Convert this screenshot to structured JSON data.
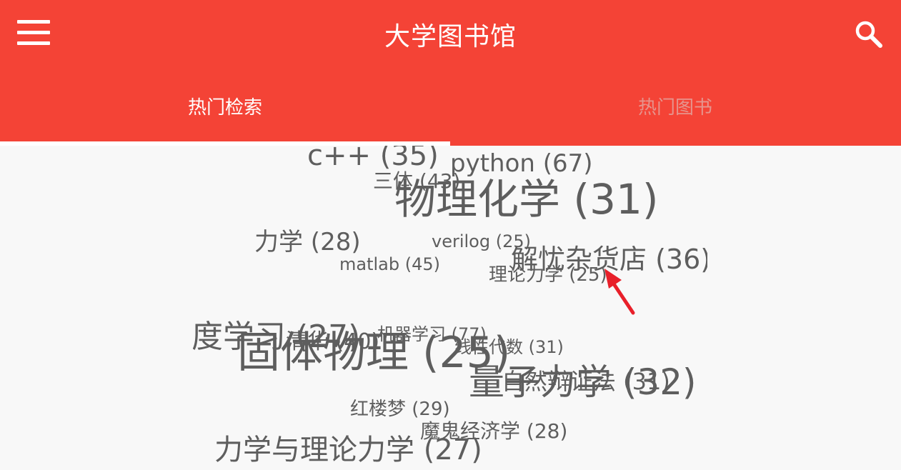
{
  "app": {
    "title": "大学图书馆",
    "menu_icon": "hamburger-menu-icon",
    "search_icon": "search-icon"
  },
  "colors": {
    "primary": "#f44336",
    "tab_active": "#ffffff",
    "tab_inactive": "#e6948d",
    "tag_text": "#5e5e5e",
    "pointer": "#e8202a"
  },
  "tabs": [
    {
      "label": "热门检索",
      "selected": true
    },
    {
      "label": "热门图书",
      "selected": false
    }
  ],
  "tag_cloud": [
    {
      "text": "c++ (35)"
    },
    {
      "text": "python (67)"
    },
    {
      "text": "三体 (43)"
    },
    {
      "text": "物理化学 (31)"
    },
    {
      "text": "力学 (28)"
    },
    {
      "text": "verilog (25)"
    },
    {
      "text": "matlab (45)"
    },
    {
      "text": "解忧杂货店 (36)"
    },
    {
      "text": "理论力学 (25)"
    },
    {
      "text": "深度学习 (27)"
    },
    {
      "text": "清华 (40)"
    },
    {
      "text": "机器学习 (77)"
    },
    {
      "text": "固体物理 (25)"
    },
    {
      "text": "线性代数 (31)"
    },
    {
      "text": "量子力学 (32)"
    },
    {
      "text": "自然辩证法 (31)"
    },
    {
      "text": "红楼梦 (29)"
    },
    {
      "text": "魔鬼经济学 (28)"
    },
    {
      "text": "力学与理论力学 (27)"
    }
  ]
}
